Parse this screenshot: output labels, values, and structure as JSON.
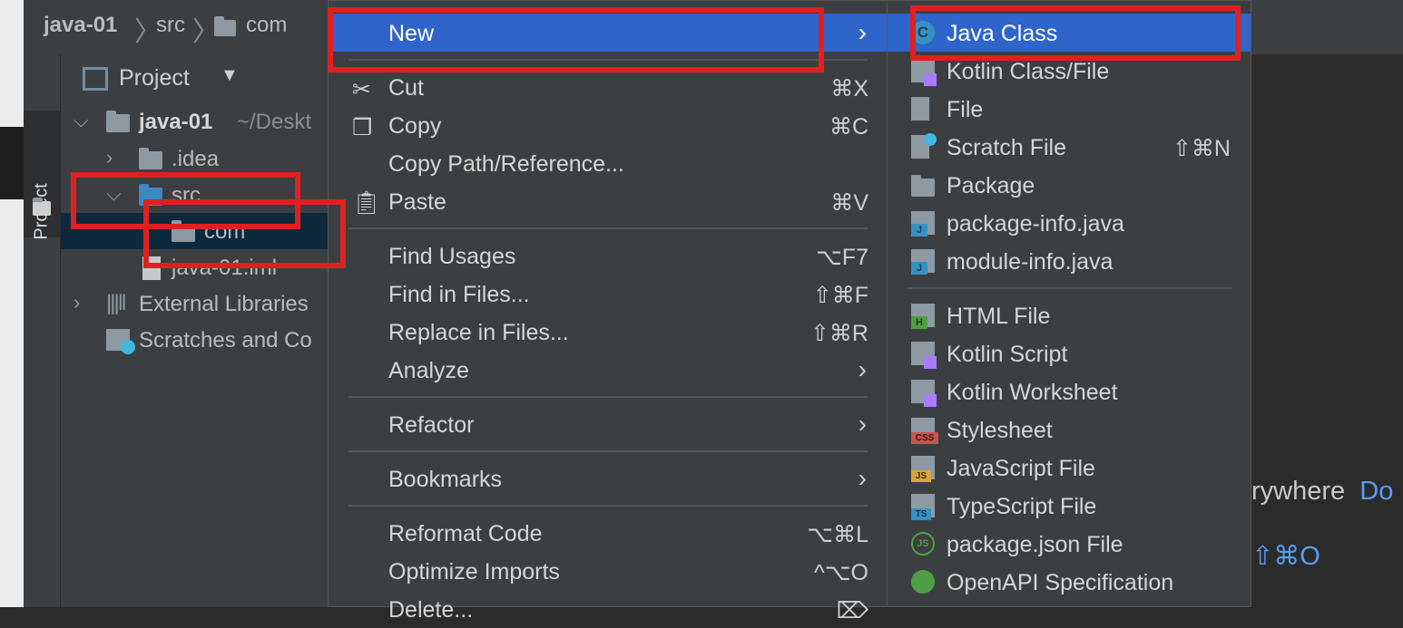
{
  "breadcrumb": {
    "project": "java-01",
    "folder": "src",
    "package": "com"
  },
  "tool_window": {
    "tab_label": "Project"
  },
  "project_panel": {
    "view_label": "Project",
    "tree": [
      {
        "label": "java-01",
        "hint": "~/Deskt"
      },
      {
        "label": ".idea"
      },
      {
        "label": "src"
      },
      {
        "label": "com"
      },
      {
        "label": "java-01.iml"
      },
      {
        "label": "External Libraries"
      },
      {
        "label": "Scratches and Co"
      }
    ]
  },
  "context_menu": {
    "items": [
      {
        "label": "New",
        "shortcut": "",
        "submenu": true
      },
      {
        "label": "Cut",
        "shortcut": "⌘X"
      },
      {
        "label": "Copy",
        "shortcut": "⌘C"
      },
      {
        "label": "Copy Path/Reference...",
        "shortcut": ""
      },
      {
        "label": "Paste",
        "shortcut": "⌘V"
      },
      {
        "label": "Find Usages",
        "shortcut": "⌥F7"
      },
      {
        "label": "Find in Files...",
        "shortcut": "⇧⌘F"
      },
      {
        "label": "Replace in Files...",
        "shortcut": "⇧⌘R"
      },
      {
        "label": "Analyze",
        "shortcut": "",
        "submenu": true
      },
      {
        "label": "Refactor",
        "shortcut": "",
        "submenu": true
      },
      {
        "label": "Bookmarks",
        "shortcut": "",
        "submenu": true
      },
      {
        "label": "Reformat Code",
        "shortcut": "⌥⌘L"
      },
      {
        "label": "Optimize Imports",
        "shortcut": "^⌥O"
      },
      {
        "label": "Delete...",
        "shortcut": "⌦"
      }
    ],
    "submenu_chevron": "›"
  },
  "new_submenu": {
    "items": [
      {
        "label": "Java Class",
        "shortcut": ""
      },
      {
        "label": "Kotlin Class/File",
        "shortcut": ""
      },
      {
        "label": "File",
        "shortcut": ""
      },
      {
        "label": "Scratch File",
        "shortcut": "⇧⌘N"
      },
      {
        "label": "Package",
        "shortcut": ""
      },
      {
        "label": "package-info.java",
        "shortcut": ""
      },
      {
        "label": "module-info.java",
        "shortcut": ""
      },
      {
        "label": "HTML File",
        "shortcut": ""
      },
      {
        "label": "Kotlin Script",
        "shortcut": ""
      },
      {
        "label": "Kotlin Worksheet",
        "shortcut": ""
      },
      {
        "label": "Stylesheet",
        "shortcut": ""
      },
      {
        "label": "JavaScript File",
        "shortcut": ""
      },
      {
        "label": "TypeScript File",
        "shortcut": ""
      },
      {
        "label": "package.json File",
        "shortcut": ""
      },
      {
        "label": "OpenAPI Specification",
        "shortcut": ""
      }
    ],
    "icon_badges": {
      "java_class": "C",
      "package_info": "J",
      "module_info": "J",
      "html": "H",
      "css": "CSS",
      "js": "JS",
      "ts": "TS",
      "package_json": "JS"
    }
  },
  "editor_hints": {
    "search_everywhere": "rywhere",
    "double_shift": "Do",
    "shortcut_fragment": "⇧⌘O"
  },
  "colors": {
    "selection": "#2f65ca",
    "highlight": "#e02020",
    "menu_bg": "#3c3f41",
    "link": "#589df6"
  }
}
